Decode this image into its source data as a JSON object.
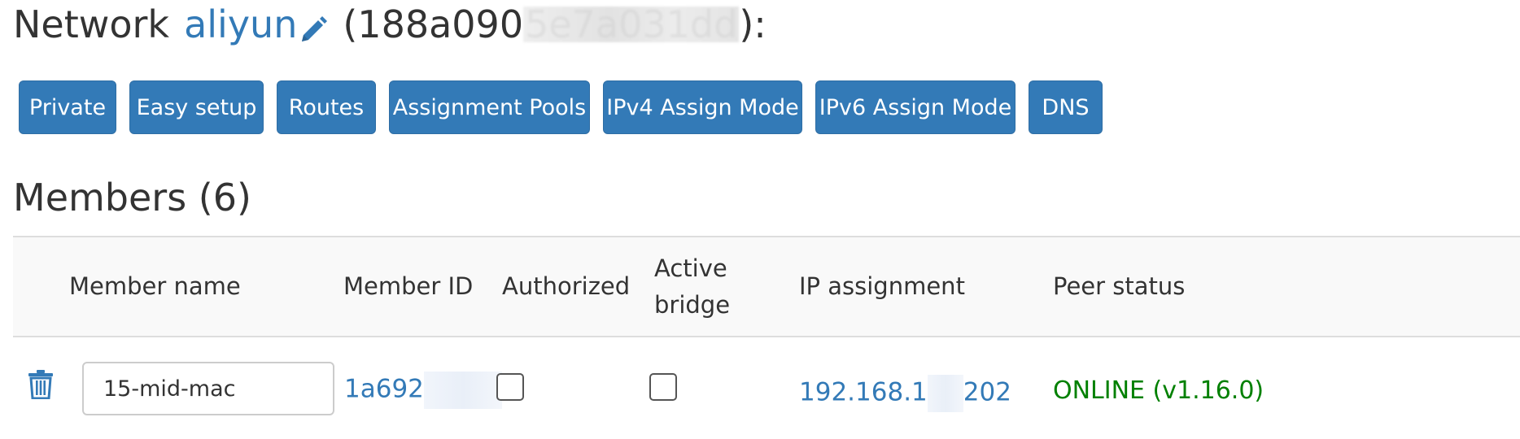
{
  "network": {
    "prefix": "Network",
    "name": "aliyun",
    "id_visible": "(188a090",
    "id_hidden": "5e7a031dd",
    "suffix": "):"
  },
  "icons": {
    "edit": "pencil-icon",
    "delete": "trash-icon"
  },
  "colors": {
    "accent": "#337ab7",
    "online": "#008000",
    "button_text": "#ffffff"
  },
  "buttons": [
    {
      "label": "Private"
    },
    {
      "label": "Easy setup"
    },
    {
      "label": "Routes"
    },
    {
      "label": "Assignment Pools"
    },
    {
      "label": "IPv4 Assign Mode"
    },
    {
      "label": "IPv6 Assign Mode"
    },
    {
      "label": "DNS"
    }
  ],
  "members": {
    "heading": "Members (6)",
    "columns": {
      "name": "Member name",
      "id": "Member ID",
      "authorized": "Authorized",
      "active_bridge_1": "Active",
      "active_bridge_2": "bridge",
      "ip": "IP assignment",
      "peer": "Peer status"
    },
    "rows": [
      {
        "name": "15-mid-mac",
        "id_visible": "1a692",
        "authorized": false,
        "active_bridge": false,
        "ip_prefix": "192.168.1",
        "ip_suffix": "202",
        "peer_status": "ONLINE (v1.16.0)"
      }
    ]
  }
}
